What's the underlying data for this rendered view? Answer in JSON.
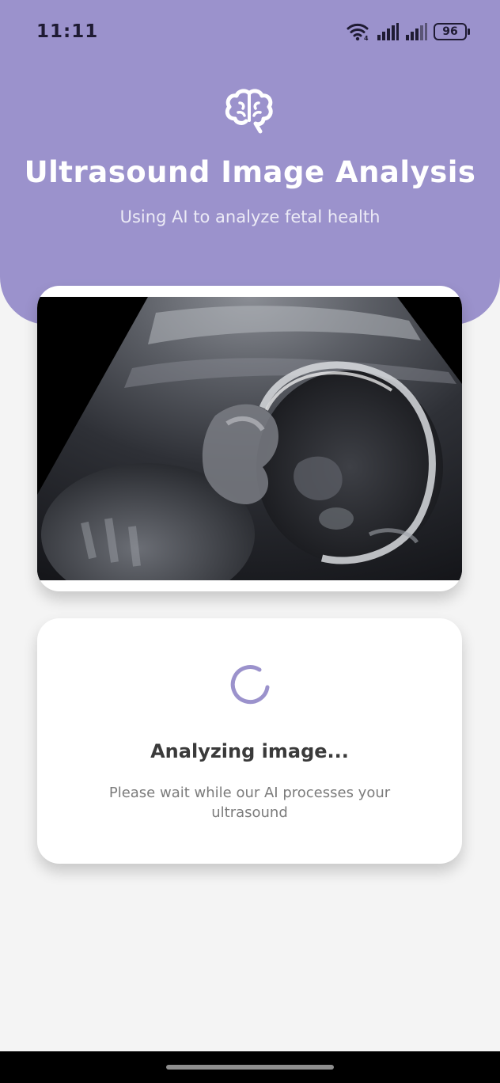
{
  "status_bar": {
    "time": "11:11",
    "battery": "96",
    "icons": [
      "wifi-icon",
      "signal-icon",
      "signal-icon",
      "battery-icon"
    ]
  },
  "header": {
    "icon": "brain-icon",
    "title": "Ultrasound Image Analysis",
    "subtitle": "Using AI to analyze fetal health"
  },
  "image_card": {
    "image": "fetal-ultrasound-scan"
  },
  "status_card": {
    "icon": "loading-spinner-icon",
    "title": "Analyzing image...",
    "description": "Please wait while our AI processes your ultrasound"
  },
  "colors": {
    "header_bg": "#9b92cc",
    "accent": "#9b92cc",
    "background": "#f4f4f4",
    "card_bg": "#ffffff"
  }
}
